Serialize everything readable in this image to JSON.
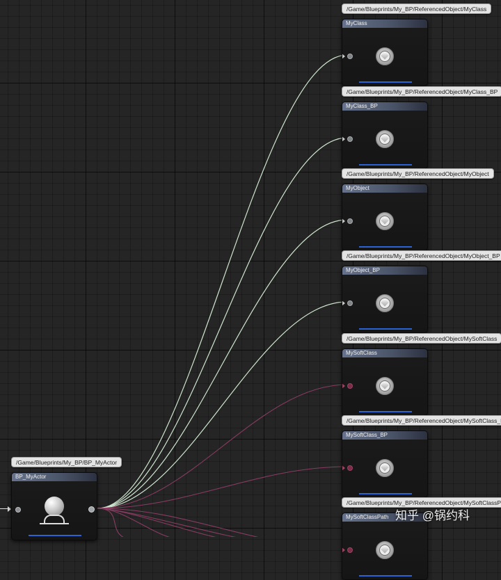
{
  "graph": {
    "nodes": [
      {
        "path": "/Game/Blueprints/My_BP/ReferencedObject/MyClass",
        "title": "MyClass",
        "pin_type": "class"
      },
      {
        "path": "/Game/Blueprints/My_BP/ReferencedObject/MyClass_BP",
        "title": "MyClass_BP",
        "pin_type": "class"
      },
      {
        "path": "/Game/Blueprints/My_BP/ReferencedObject/MyObject",
        "title": "MyObject",
        "pin_type": "object"
      },
      {
        "path": "/Game/Blueprints/My_BP/ReferencedObject/MyObject_BP",
        "title": "MyObject_BP",
        "pin_type": "object"
      },
      {
        "path": "/Game/Blueprints/My_BP/ReferencedObject/MySoftClass",
        "title": "MySoftClass",
        "pin_type": "soft"
      },
      {
        "path": "/Game/Blueprints/My_BP/ReferencedObject/MySoftClass_BP",
        "title": "MySoftClass_BP",
        "pin_type": "soft"
      },
      {
        "path": "/Game/Blueprints/My_BP/ReferencedObject/MySoftClassPath",
        "title": "MySoftClassPath",
        "pin_type": "soft"
      }
    ],
    "actor": {
      "path": "/Game/Blueprints/My_BP/BP_MyActor",
      "title": "BP_MyActor"
    }
  },
  "colors": {
    "hard_reference_wire": "#cfe6cf",
    "soft_reference_wire": "#8a3c62",
    "node_header": "#5f6b85",
    "asset_bar": "#2a63d4",
    "background": "#252525"
  },
  "watermark": "知乎 @锅约科"
}
